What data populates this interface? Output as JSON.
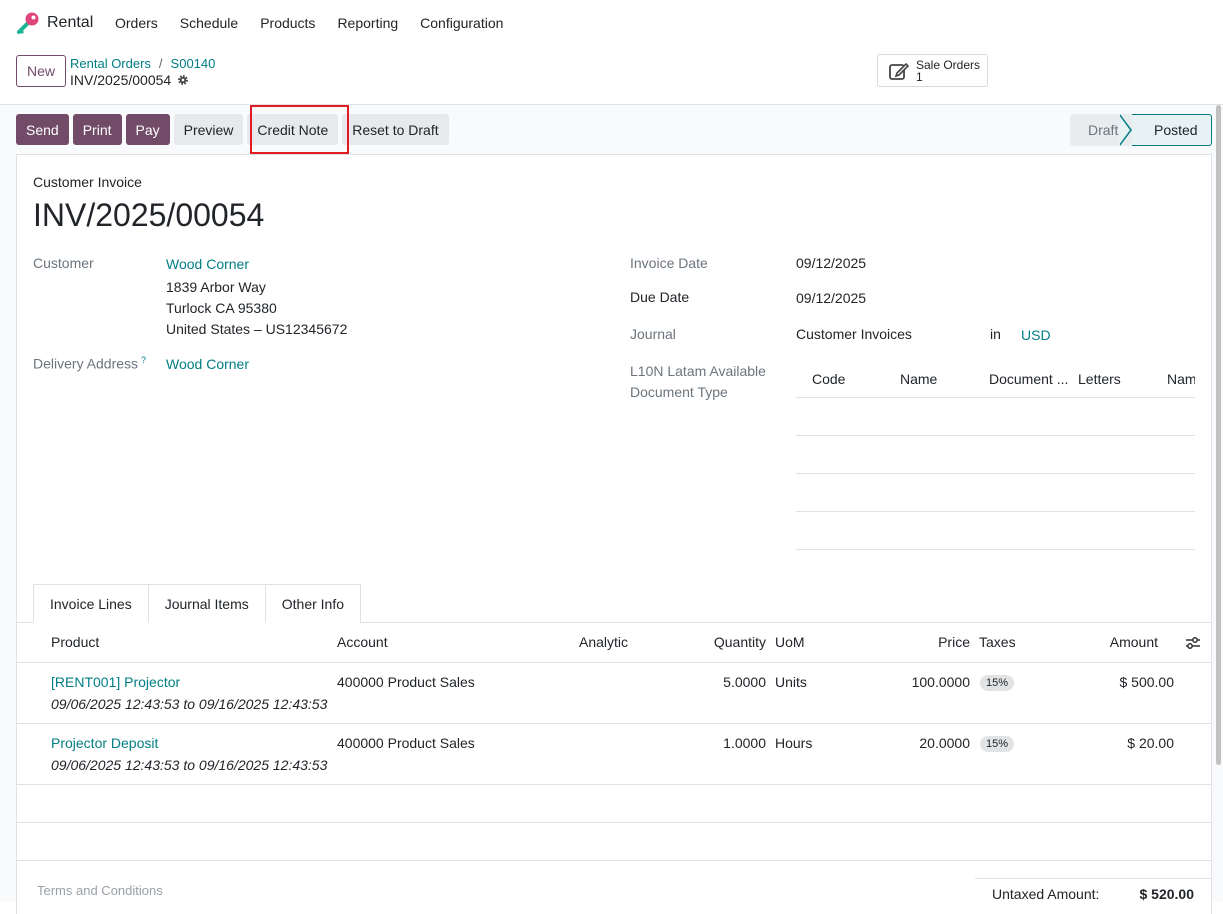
{
  "app": {
    "name": "Rental",
    "logo_icon": "rental-key-icon"
  },
  "menu": [
    "Orders",
    "Schedule",
    "Products",
    "Reporting",
    "Configuration"
  ],
  "control": {
    "new_label": "New",
    "breadcrumb": [
      "Rental Orders",
      "S00140"
    ],
    "record": "INV/2025/00054",
    "smart_button": {
      "label": "Sale Orders",
      "count": "1"
    }
  },
  "actions": {
    "primary": [
      "Send",
      "Print",
      "Pay"
    ],
    "secondary": [
      "Preview",
      "Credit Note",
      "Reset to Draft"
    ]
  },
  "status": {
    "draft": "Draft",
    "posted": "Posted"
  },
  "form": {
    "doc_type": "Customer Invoice",
    "doc_name": "INV/2025/00054",
    "customer_label": "Customer",
    "customer": "Wood Corner",
    "address1": "1839 Arbor Way",
    "address2": "Turlock CA 95380",
    "address3": "United States – US12345672",
    "delivery_label": "Delivery Address",
    "delivery_help": "?",
    "delivery": "Wood Corner",
    "invoice_date_label": "Invoice Date",
    "invoice_date": "09/12/2025",
    "due_date_label": "Due Date",
    "due_date": "09/12/2025",
    "journal_label": "Journal",
    "journal": "Customer Invoices",
    "in_label": "in",
    "currency": "USD",
    "l10n_label1": "L10N Latam Available",
    "l10n_label2": "Document Type",
    "l10n_cols": [
      "Code",
      "Name",
      "Document ...",
      "Letters",
      "Nam"
    ]
  },
  "tabs": [
    "Invoice Lines",
    "Journal Items",
    "Other Info"
  ],
  "lines": {
    "headers": [
      "Product",
      "Account",
      "Analytic",
      "Quantity",
      "UoM",
      "Price",
      "Taxes",
      "Amount"
    ],
    "rows": [
      {
        "product": "[RENT001] Projector",
        "dates": "09/06/2025 12:43:53 to 09/16/2025 12:43:53",
        "account": "400000 Product Sales",
        "quantity": "5.0000",
        "uom": "Units",
        "price": "100.0000",
        "tax": "15%",
        "amount": "$ 500.00"
      },
      {
        "product": "Projector Deposit",
        "dates": "09/06/2025 12:43:53 to 09/16/2025 12:43:53",
        "account": "400000 Product Sales",
        "quantity": "1.0000",
        "uom": "Hours",
        "price": "20.0000",
        "tax": "15%",
        "amount": "$ 20.00"
      }
    ]
  },
  "footer": {
    "terms": "Terms and Conditions",
    "untaxed_label": "Untaxed Amount:",
    "untaxed_value": "$ 520.00"
  }
}
